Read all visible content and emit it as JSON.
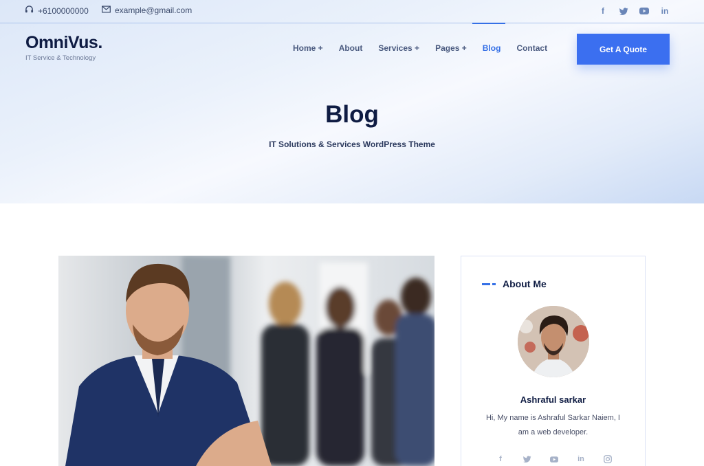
{
  "topbar": {
    "phone": "+6100000000",
    "email": "example@gmail.com",
    "social": [
      "facebook-icon",
      "twitter-icon",
      "youtube-icon",
      "linkedin-icon"
    ]
  },
  "header": {
    "logo_title": "OmniVus.",
    "logo_sub": "IT Service & Technology",
    "nav": [
      {
        "label": "Home +"
      },
      {
        "label": "About"
      },
      {
        "label": "Services +"
      },
      {
        "label": "Pages +"
      },
      {
        "label": "Blog",
        "active": true
      },
      {
        "label": "Contact"
      }
    ],
    "cta": "Get A Quote"
  },
  "hero": {
    "title": "Blog",
    "subtitle": "IT Solutions & Services WordPress Theme"
  },
  "about_widget": {
    "title": "About Me",
    "name": "Ashraful sarkar",
    "bio": "Hi, My name is Ashraful Sarkar Naiem, I am a web developer.",
    "social": [
      "facebook-icon",
      "twitter-icon",
      "youtube-icon",
      "linkedin-icon",
      "instagram-icon"
    ]
  },
  "colors": {
    "accent": "#3570e6",
    "heading": "#0f1c43"
  }
}
